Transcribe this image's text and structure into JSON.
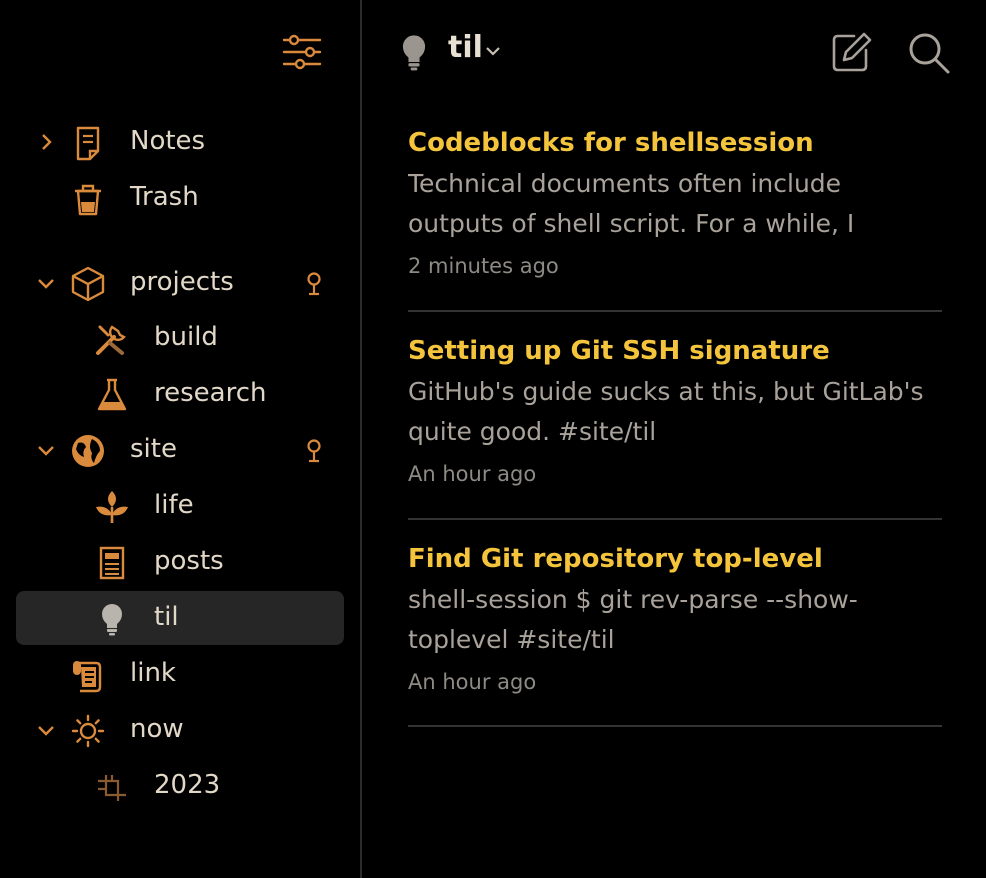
{
  "sidebar": {
    "items": [
      {
        "label": "Notes",
        "icon": "note-icon"
      },
      {
        "label": "Trash",
        "icon": "trash-icon"
      },
      {
        "label": "projects",
        "icon": "cube-icon"
      },
      {
        "label": "build",
        "icon": "tools-icon"
      },
      {
        "label": "research",
        "icon": "flask-icon"
      },
      {
        "label": "site",
        "icon": "globe-icon"
      },
      {
        "label": "life",
        "icon": "plant-icon"
      },
      {
        "label": "posts",
        "icon": "newspaper-icon"
      },
      {
        "label": "til",
        "icon": "bulb-icon"
      },
      {
        "label": "link",
        "icon": "scroll-icon"
      },
      {
        "label": "now",
        "icon": "sun-icon"
      },
      {
        "label": "2023",
        "icon": "crop-icon"
      }
    ],
    "selected": "til"
  },
  "header": {
    "title": "til"
  },
  "notes": [
    {
      "title": "Codeblocks for shellsession",
      "snippet": "Technical documents often include outputs of shell script. For a while, I have…",
      "time": "2 minutes ago"
    },
    {
      "title": "Setting up Git SSH signature",
      "snippet": "GitHub's guide sucks at this, but GitLab's quite good. #site/til",
      "time": "An hour ago"
    },
    {
      "title": "Find Git repository top-level",
      "snippet": "shell-session $ git rev-parse --show-toplevel #site/til",
      "time": "An hour ago"
    }
  ],
  "colors": {
    "accent": "#f4c53c",
    "icon": "#d98a3c",
    "background": "#000000",
    "selected": "#262626"
  }
}
